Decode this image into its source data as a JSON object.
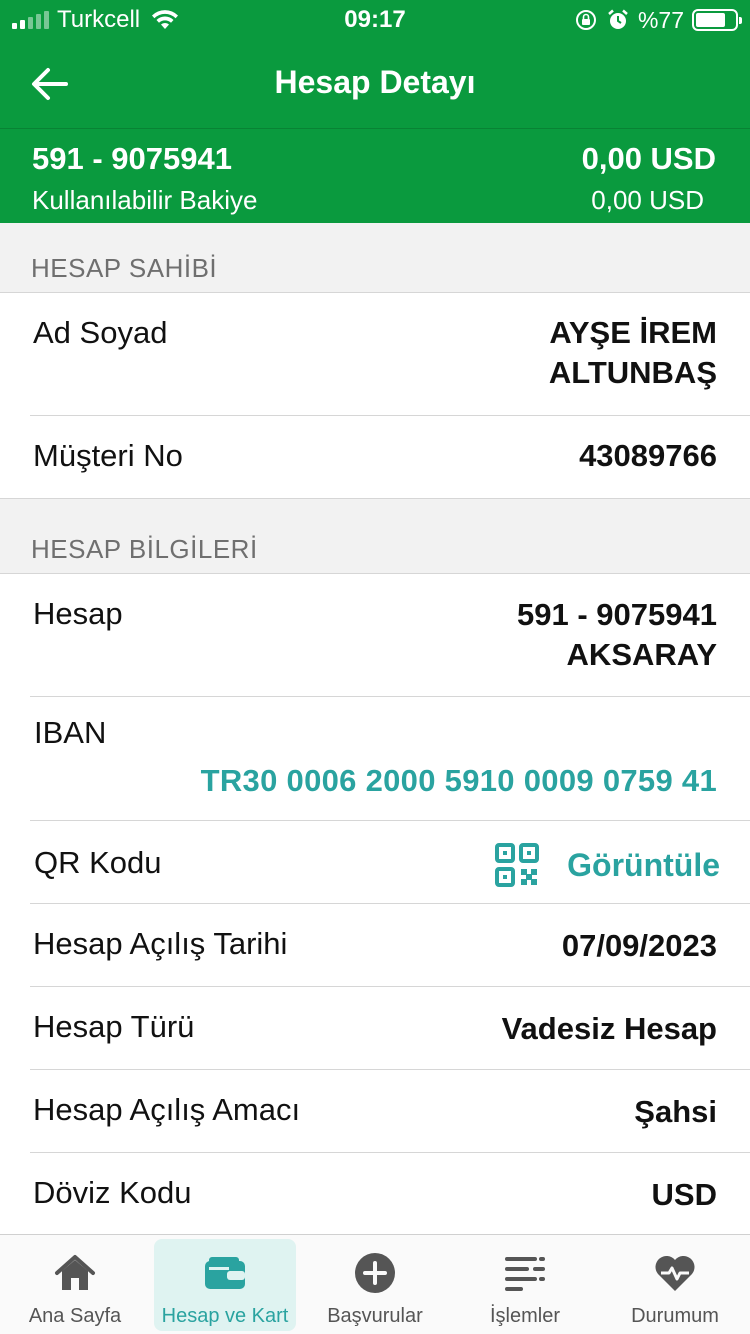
{
  "status_bar": {
    "carrier": "Turkcell",
    "time": "09:17",
    "battery": "%77",
    "battery_level": 0.77,
    "signal_bars_on": 2
  },
  "header": {
    "title": "Hesap Detayı",
    "back_icon": "arrow-left-icon"
  },
  "summary": {
    "account_number": "591 - 9075941",
    "available_label": "Kullanılabilir Bakiye",
    "balance": "0,00 USD",
    "available_balance": "0,00 USD"
  },
  "sections": {
    "owner": {
      "title": "HESAP SAHİBİ",
      "name_label": "Ad Soyad",
      "name_line1": "AYŞE İREM",
      "name_line2": "ALTUNBAŞ",
      "customer_label": "Müşteri No",
      "customer_no": "43089766"
    },
    "account": {
      "title": "HESAP BİLGİLERİ",
      "account_label": "Hesap",
      "account_line1": "591 - 9075941",
      "account_line2": "AKSARAY",
      "iban_label": "IBAN",
      "iban": "TR30 0006 2000 5910 0009 0759 41",
      "qr_label": "QR Kodu",
      "qr_action": "Görüntüle",
      "open_date_label": "Hesap Açılış Tarihi",
      "open_date": "07/09/2023",
      "type_label": "Hesap Türü",
      "type": "Vadesiz Hesap",
      "purpose_label": "Hesap Açılış Amacı",
      "purpose": "Şahsi",
      "currency_label": "Döviz Kodu",
      "currency": "USD"
    }
  },
  "tabs": [
    {
      "label": "Ana Sayfa",
      "icon": "home-icon",
      "active": false
    },
    {
      "label": "Hesap ve Kart",
      "icon": "wallet-icon",
      "active": true
    },
    {
      "label": "Başvurular",
      "icon": "plus-circle-icon",
      "active": false
    },
    {
      "label": "İşlemler",
      "icon": "list-icon",
      "active": false
    },
    {
      "label": "Durumum",
      "icon": "heart-pulse-icon",
      "active": false
    }
  ],
  "colors": {
    "brand_green": "#0a9a3e",
    "accent_teal": "#2aa3a0"
  }
}
